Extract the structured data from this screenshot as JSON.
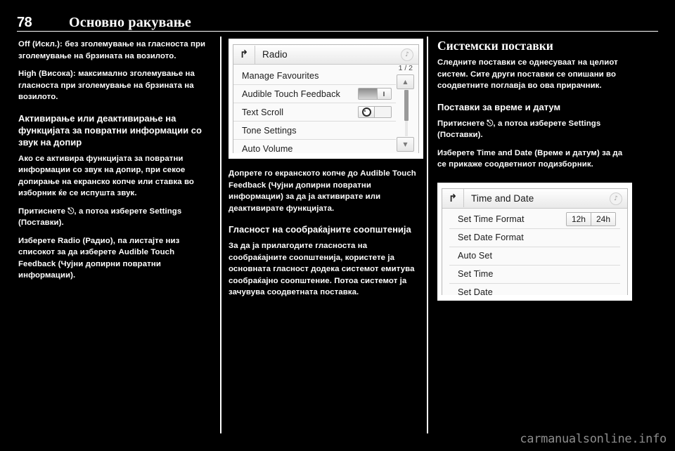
{
  "header": {
    "page_number": "78",
    "title": "Основно ракување"
  },
  "column_left": {
    "paragraphs": [
      {
        "lead": "Off (Искл.):",
        "text": " без зголемување на гласноста при зголемување на брзината на возилото."
      },
      {
        "lead": "High (Висока):",
        "text": " максимално зголемување на гласноста при зголемување на брзината на возилото."
      }
    ],
    "subheading": "Активирање или деактивирање на функцијата за повратни информации со звук на допир",
    "paragraphs2": [
      {
        "lead": "",
        "text": "Ако се активира функцијата за повратни информации со звук на допир, при секое допирање на екранско копче или ставка во изборник ќе се испушта звук."
      },
      {
        "lead": "",
        "text": "Притиснете ⎋, а потоа изберете Settings (Поставки)."
      },
      {
        "lead": "",
        "text": "Изберете Radio (Радио), па листајте низ списокот за да изберете Audible Touch Feedback (Чујни допирни повратни информации)."
      }
    ]
  },
  "radio_screen": {
    "title": "Radio",
    "back_icon": "back-arrow-icon",
    "note_icon": "music-note-icon",
    "page_indicator": "1 / 2",
    "up_arrow": "▲",
    "down_arrow": "▼",
    "rows": [
      {
        "label": "Manage Favourites",
        "control": "none"
      },
      {
        "label": "Audible Touch Feedback",
        "control": "toggle-on"
      },
      {
        "label": "Text Scroll",
        "control": "toggle-off"
      },
      {
        "label": "Tone Settings",
        "control": "none"
      },
      {
        "label": "Auto Volume",
        "control": "none"
      }
    ]
  },
  "column_middle": {
    "paragraphs": [
      {
        "lead": "",
        "text": "Допрете го екранското копче до Audible Touch Feedback (Чујни допирни повратни информации) за да ја активирате или деактивирате функцијата."
      }
    ],
    "subheading": "Гласност на сообраќајните соопштенија",
    "paragraphs2": [
      {
        "lead": "",
        "text": "За да ја прилагодите гласноста на сообраќајните соопштенија, користете ја основната гласност додека системот емитува сообраќајно соопштение. Потоа системот ја зачувува соодветната поставка."
      }
    ]
  },
  "column_right": {
    "section_title": "Системски поставки",
    "paragraphs": [
      {
        "lead": "",
        "text": "Следните поставки се однесуваат на целиот систем. Сите други поставки се опишани во соодветните поглавја во ова прирачник."
      }
    ],
    "subheading": "Поставки за време и датум",
    "paragraphs2": [
      {
        "lead": "",
        "text": "Притиснете ⎋, а потоа изберете Settings (Поставки)."
      },
      {
        "lead": "",
        "text": "Изберете Time and Date (Време и датум) за да се прикаже соодветниот подизборник."
      }
    ]
  },
  "time_date_screen": {
    "title": "Time and Date",
    "back_icon": "back-arrow-icon",
    "note_icon": "music-note-icon",
    "rows": [
      {
        "label": "Set Time Format",
        "control": "segmented",
        "options": [
          "12h",
          "24h"
        ]
      },
      {
        "label": "Set Date Format",
        "control": "none"
      },
      {
        "label": "Auto Set",
        "control": "none"
      },
      {
        "label": "Set Time",
        "control": "none"
      },
      {
        "label": "Set Date",
        "control": "none"
      }
    ]
  },
  "watermark": "carmanualsonline.info"
}
